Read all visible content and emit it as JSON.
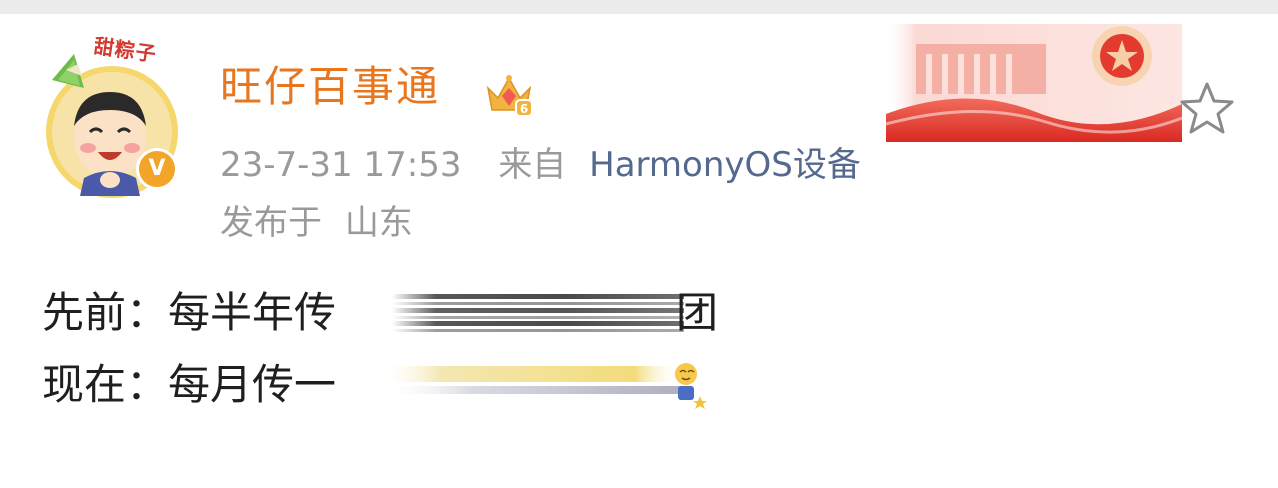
{
  "post": {
    "author": {
      "name": "旺仔百事通",
      "avatar_pendant_label": "甜粽子",
      "verified_badge": "V",
      "vip_level": "6"
    },
    "meta": {
      "date": "23-7-31 17:53",
      "from_label": "来自",
      "source": "HarmonyOS设备",
      "location_label": "发布于",
      "location": "山东"
    },
    "content": {
      "line1_prefix": "先前：每半年传",
      "line1_tail": "团",
      "line2_prefix": "现在：每月传一"
    }
  },
  "icons": {
    "favorite": "star-outline-icon",
    "vip": "crown-gem-icon",
    "verified": "verified-v-icon"
  },
  "colors": {
    "username": "#e8761e",
    "meta_gray": "#9a9a9a",
    "source_link": "#55698f",
    "body_text": "#1f1f1f",
    "verified_badge": "#f3a52a"
  }
}
